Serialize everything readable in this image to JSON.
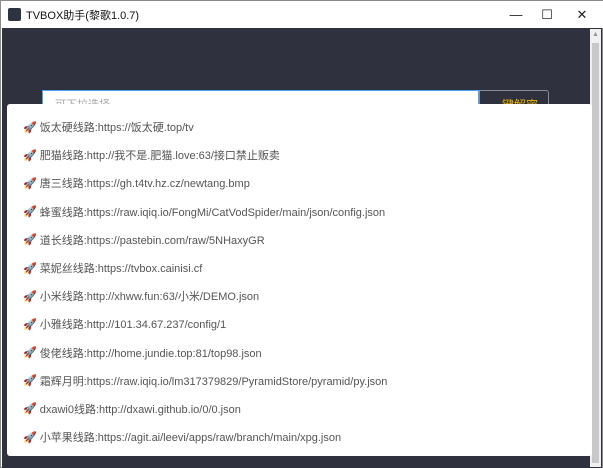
{
  "window": {
    "title": "TVBOX助手(黎歌1.0.7)",
    "minimize": "—",
    "maximize": "☐",
    "close": "✕"
  },
  "search": {
    "placeholder": "可下拉选择",
    "button": "一键解密"
  },
  "options": [
    "饭太硬线路:https://饭太硬.top/tv",
    "肥猫线路:http://我不是.肥猫.love:63/接口禁止贩卖",
    "唐三线路:https://gh.t4tv.hz.cz/newtang.bmp",
    "蜂蜜线路:https://raw.iqiq.io/FongMi/CatVodSpider/main/json/config.json",
    "道长线路:https://pastebin.com/raw/5NHaxyGR",
    "菜妮丝线路:https://tvbox.cainisi.cf",
    "小米线路:http://xhww.fun:63/小米/DEMO.json",
    "小雅线路:http://101.34.67.237/config/1",
    "俊佬线路:http://home.jundie.top:81/top98.json",
    "霜辉月明:https://raw.iqiq.io/lm317379829/PyramidStore/pyramid/py.json",
    "dxawi0线路:http://dxawi.github.io/0/0.json",
    "小苹果线路:https://agit.ai/leevi/apps/raw/branch/main/xpg.json"
  ],
  "icon": "🚀"
}
